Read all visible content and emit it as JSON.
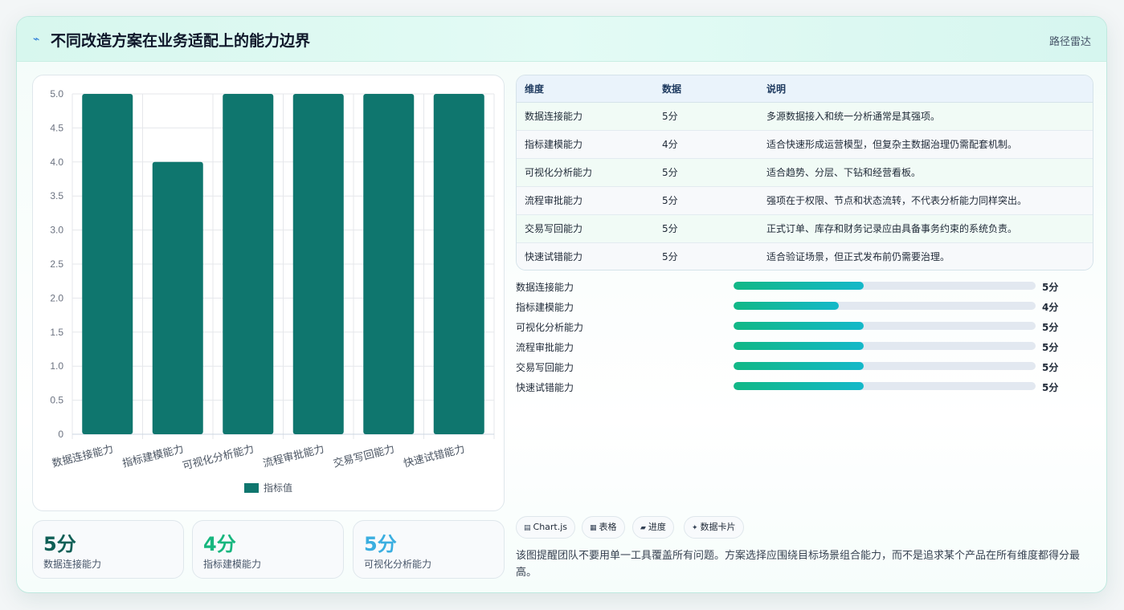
{
  "header": {
    "title_icon": "chart-trend-icon",
    "title": "不同改造方案在业务适配上的能力边界",
    "route_label": "路径雷达"
  },
  "chart_data": {
    "type": "bar",
    "categories": [
      "数据连接能力",
      "指标建模能力",
      "可视化分析能力",
      "流程审批能力",
      "交易写回能力",
      "快速试错能力"
    ],
    "series": [
      {
        "name": "指标值",
        "values": [
          5,
          4,
          5,
          5,
          5,
          5
        ],
        "color": "#0f766e"
      }
    ],
    "ylim": [
      0,
      5
    ],
    "yticks": [
      "0",
      "0.5",
      "1.0",
      "1.5",
      "2.0",
      "2.5",
      "3.0",
      "3.5",
      "4.0",
      "4.5",
      "5.0"
    ],
    "grid": true,
    "legend": "bottom"
  },
  "stats": [
    {
      "value": "5分",
      "label": "数据连接能力",
      "color": "#0f5f56"
    },
    {
      "value": "4分",
      "label": "指标建模能力",
      "color": "#16b67e"
    },
    {
      "value": "5分",
      "label": "可视化分析能力",
      "color": "#3aaee0"
    }
  ],
  "table": {
    "headers": [
      "维度",
      "数据",
      "说明"
    ],
    "rows": [
      [
        "数据连接能力",
        "5分",
        "多源数据接入和统一分析通常是其强项。"
      ],
      [
        "指标建模能力",
        "4分",
        "适合快速形成运营模型，但复杂主数据治理仍需配套机制。"
      ],
      [
        "可视化分析能力",
        "5分",
        "适合趋势、分层、下钻和经营看板。"
      ],
      [
        "流程审批能力",
        "5分",
        "强项在于权限、节点和状态流转，不代表分析能力同样突出。"
      ],
      [
        "交易写回能力",
        "5分",
        "正式订单、库存和财务记录应由具备事务约束的系统负责。"
      ],
      [
        "快速试错能力",
        "5分",
        "适合验证场景，但正式发布前仍需要治理。"
      ]
    ]
  },
  "progress": [
    {
      "label": "数据连接能力",
      "value": "5分",
      "fraction": 0.432
    },
    {
      "label": "指标建模能力",
      "value": "4分",
      "fraction": 0.349
    },
    {
      "label": "可视化分析能力",
      "value": "5分",
      "fraction": 0.432
    },
    {
      "label": "流程审批能力",
      "value": "5分",
      "fraction": 0.432
    },
    {
      "label": "交易写回能力",
      "value": "5分",
      "fraction": 0.432
    },
    {
      "label": "快速试错能力",
      "value": "5分",
      "fraction": 0.432
    }
  ],
  "tags": [
    {
      "icon": "chart-icon",
      "label": "Chart.js"
    },
    {
      "icon": "table-icon",
      "label": "表格"
    },
    {
      "icon": "progress-icon",
      "label": "进度"
    },
    {
      "icon": "sparkle-icon",
      "label": "数据卡片"
    }
  ],
  "note": "该图提醒团队不要用单一工具覆盖所有问题。方案选择应围绕目标场景组合能力，而不是追求某个产品在所有维度都得分最高。"
}
